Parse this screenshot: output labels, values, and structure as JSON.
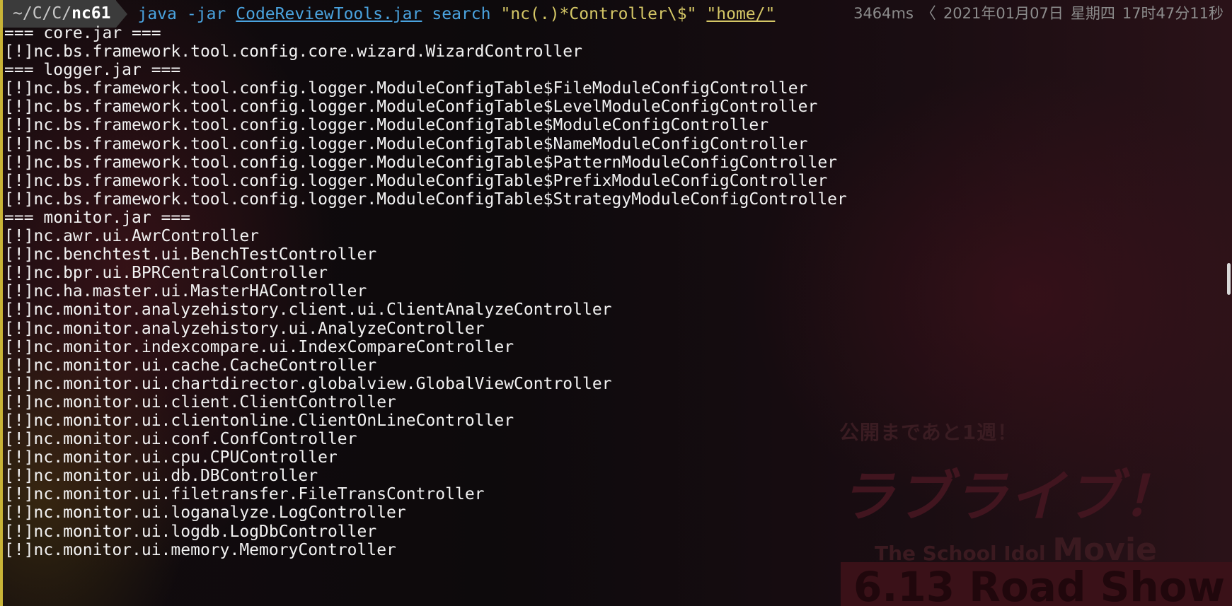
{
  "prompt": {
    "dir_prefix": "~/C/C/",
    "dir_current": "nc61",
    "command": {
      "program": "java",
      "flag": "-jar",
      "jar": "CodeReviewTools.jar",
      "subcommand": "search",
      "pattern": "\"nc(.)*Controller\\$\"",
      "path": "\"home/\""
    },
    "right": {
      "duration": "3464ms",
      "chevron": "〈",
      "date": "2021年01月07日",
      "weekday": "星期四",
      "time": "17时47分11秒"
    }
  },
  "output_lines": [
    "=== core.jar ===",
    "[!]nc.bs.framework.tool.config.core.wizard.WizardController",
    "=== logger.jar ===",
    "[!]nc.bs.framework.tool.config.logger.ModuleConfigTable$FileModuleConfigController",
    "[!]nc.bs.framework.tool.config.logger.ModuleConfigTable$LevelModuleConfigController",
    "[!]nc.bs.framework.tool.config.logger.ModuleConfigTable$ModuleConfigController",
    "[!]nc.bs.framework.tool.config.logger.ModuleConfigTable$NameModuleConfigController",
    "[!]nc.bs.framework.tool.config.logger.ModuleConfigTable$PatternModuleConfigController",
    "[!]nc.bs.framework.tool.config.logger.ModuleConfigTable$PrefixModuleConfigController",
    "[!]nc.bs.framework.tool.config.logger.ModuleConfigTable$StrategyModuleConfigController",
    "=== monitor.jar ===",
    "[!]nc.awr.ui.AwrController",
    "[!]nc.benchtest.ui.BenchTestController",
    "[!]nc.bpr.ui.BPRCentralController",
    "[!]nc.ha.master.ui.MasterHAController",
    "[!]nc.monitor.analyzehistory.client.ui.ClientAnalyzeController",
    "[!]nc.monitor.analyzehistory.ui.AnalyzeController",
    "[!]nc.monitor.indexcompare.ui.IndexCompareController",
    "[!]nc.monitor.ui.cache.CacheController",
    "[!]nc.monitor.ui.chartdirector.globalview.GlobalViewController",
    "[!]nc.monitor.ui.client.ClientController",
    "[!]nc.monitor.ui.clientonline.ClientOnLineController",
    "[!]nc.monitor.ui.conf.ConfController",
    "[!]nc.monitor.ui.cpu.CPUController",
    "[!]nc.monitor.ui.db.DBController",
    "[!]nc.monitor.ui.filetransfer.FileTransController",
    "[!]nc.monitor.ui.loganalyze.LogController",
    "[!]nc.monitor.ui.logdb.LogDbController",
    "[!]nc.monitor.ui.memory.MemoryController"
  ],
  "background": {
    "subtitle": "公開まであと1週！",
    "title": "ラブライブ！",
    "tagline_small": "The School Idol",
    "tagline_big": "Movie",
    "date_banner": "6.13 Road Show"
  },
  "colors": {
    "accent_border": "#c9b437",
    "command_blue": "#4aa3df",
    "string_yellow": "#d5c766",
    "dim_text": "#8c8c8c"
  }
}
